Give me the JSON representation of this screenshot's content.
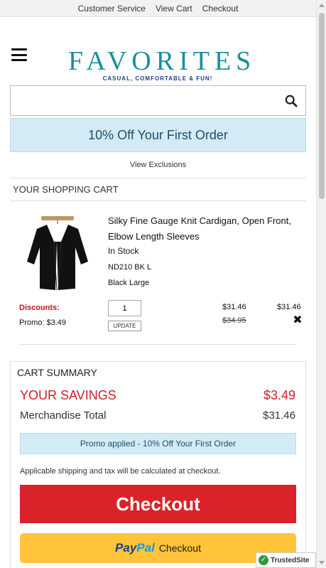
{
  "topnav": {
    "customer_service": "Customer Service",
    "view_cart": "View Cart",
    "checkout": "Checkout"
  },
  "header": {
    "logo_text": "FAVORITES",
    "logo_tagline": "CASUAL, COMFORTABLE & FUN!",
    "menu_icon": "hamburger-menu-icon"
  },
  "search": {
    "value": "",
    "placeholder": "",
    "icon": "search-icon"
  },
  "promo_banner": {
    "text": "10% Off Your First Order",
    "exclusions_link": "View Exclusions"
  },
  "cart": {
    "title": "YOUR SHOPPING CART",
    "items": [
      {
        "name": "Silky Fine Gauge Knit Cardigan, Open Front, Elbow Length Sleeves",
        "stock": "In Stock",
        "sku": "ND210 BK L",
        "variant": "Black Large",
        "discounts_label": "Discounts:",
        "promo": "Promo: $3.49",
        "quantity": "1",
        "update_label": "UPDATE",
        "price": "$31.46",
        "original_price": "$34.95",
        "total": "$31.46",
        "remove_icon": "close-icon"
      }
    ]
  },
  "summary": {
    "title": "CART SUMMARY",
    "savings_label": "YOUR SAVINGS",
    "savings_value": "$3.49",
    "merch_label": "Merchandise Total",
    "merch_value": "$31.46",
    "promo_applied": "Promo applied - 10% Off Your First Order",
    "shipping_note": "Applicable shipping and tax will be calculated at checkout.",
    "checkout_label": "Checkout",
    "paypal_pay": "Pay",
    "paypal_pal": "Pal",
    "paypal_checkout": "Checkout"
  },
  "trusted_badge": {
    "label": "TrustedSite"
  },
  "colors": {
    "brand_teal": "#1a8f9b",
    "savings_red": "#d01f26",
    "checkout_red": "#d9222a",
    "paypal_yellow": "#ffc439",
    "promo_blue": "#d3ebf4"
  }
}
